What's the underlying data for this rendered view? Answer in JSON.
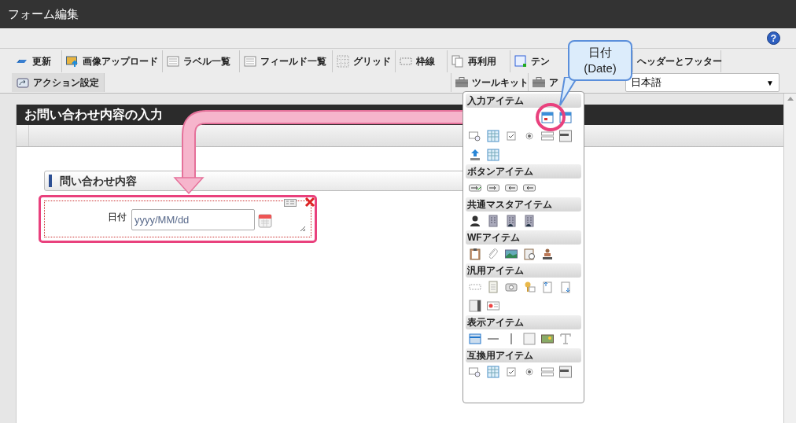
{
  "window": {
    "title": "フォーム編集"
  },
  "toolbar": {
    "help_button": "?",
    "tabs_row_1": [
      {
        "label": "更新",
        "selected": false
      },
      {
        "label": "画像アップロード",
        "selected": false
      },
      {
        "label": "ラベル一覧",
        "selected": false
      },
      {
        "label": "フィールド一覧",
        "selected": false
      },
      {
        "label": "グリッド",
        "selected": false
      },
      {
        "label": "枠線",
        "selected": false
      },
      {
        "label": "再利用",
        "selected": false
      },
      {
        "label": "テン",
        "selected": false
      },
      {
        "label": "ヘッダーとフッター",
        "selected": false
      }
    ],
    "tabs_row_2_left": [
      {
        "label": "アクション設定",
        "selected": true
      }
    ],
    "tabs_row_2_right": [
      {
        "label": "ツールキット",
        "selected": false
      },
      {
        "label": "ア",
        "selected": false
      }
    ],
    "language_select": {
      "value": "日本語",
      "arrow": "▼"
    }
  },
  "form": {
    "title": "お問い合わせ内容の入力",
    "section_title": "問い合わせ内容",
    "field": {
      "label": "日付",
      "placeholder": "yyyy/MM/dd"
    }
  },
  "palette": {
    "sections": [
      {
        "title": "入力アイテム"
      },
      {
        "title": "ボタンアイテム"
      },
      {
        "title": "共通マスタアイテム"
      },
      {
        "title": "WFアイテム"
      },
      {
        "title": "汎用アイテム"
      },
      {
        "title": "表示アイテム"
      },
      {
        "title": "互換用アイテム"
      }
    ]
  },
  "callout": {
    "lines": [
      "日付",
      "(Date)"
    ]
  }
}
